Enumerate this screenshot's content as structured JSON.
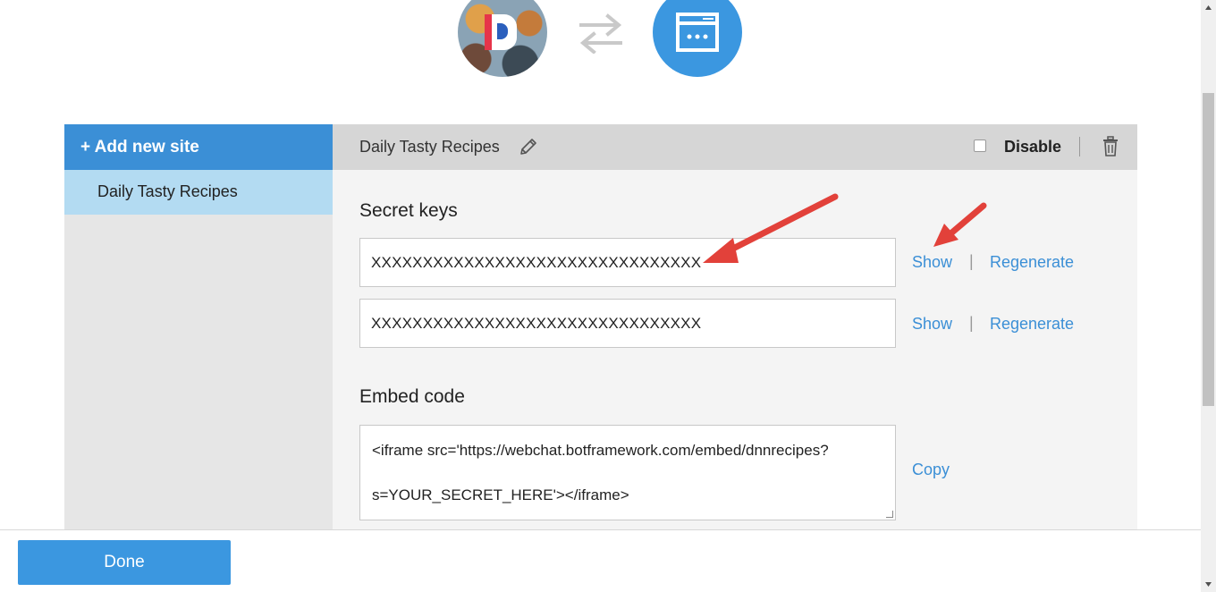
{
  "header": {
    "bot_avatar_icon": "bot-avatar-icon",
    "swap_icon": "swap-arrows-icon",
    "channel_icon": "webchat-window-icon"
  },
  "sidebar": {
    "add_site_label": "+ Add new site",
    "items": [
      {
        "label": "Daily Tasty Recipes",
        "selected": true
      }
    ]
  },
  "site": {
    "title": "Daily Tasty Recipes",
    "disable_label": "Disable",
    "disabled": false
  },
  "secret_keys": {
    "title": "Secret keys",
    "keys": [
      {
        "value": "XXXXXXXXXXXXXXXXXXXXXXXXXXXXXXXX",
        "show_label": "Show",
        "regenerate_label": "Regenerate"
      },
      {
        "value": "XXXXXXXXXXXXXXXXXXXXXXXXXXXXXXXX",
        "show_label": "Show",
        "regenerate_label": "Regenerate"
      }
    ],
    "separator": "|"
  },
  "embed": {
    "title": "Embed code",
    "line1": "<iframe src='https://webchat.botframework.com/embed/dnnrecipes?",
    "line2": "s=YOUR_SECRET_HERE'></iframe>",
    "copy_label": "Copy"
  },
  "footer": {
    "done_label": "Done"
  },
  "colors": {
    "accent": "#3b8fd6",
    "selected_item": "#b3dbf2",
    "annotation_arrow": "#e2413a"
  }
}
